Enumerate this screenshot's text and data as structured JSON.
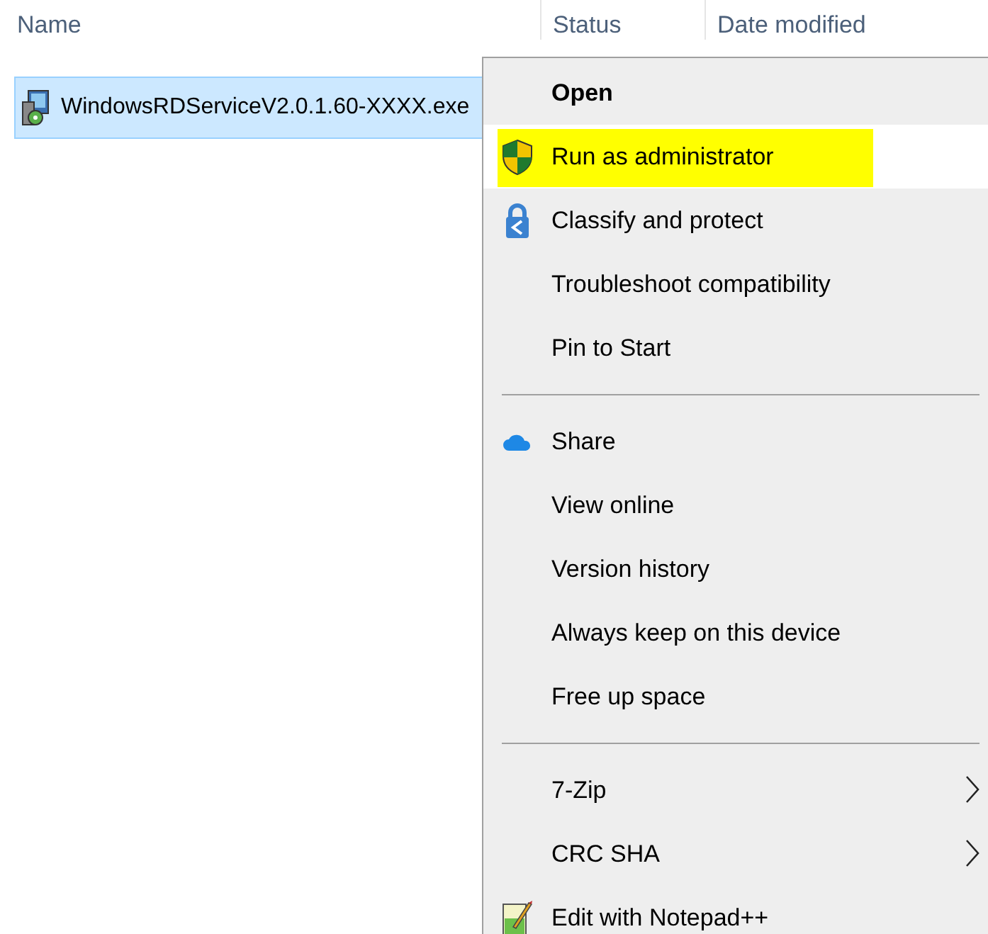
{
  "columns": [
    {
      "label": "Name"
    },
    {
      "label": "Status"
    },
    {
      "label": "Date modified"
    }
  ],
  "files": [
    {
      "name": "WindowsRDServiceV2.0.1.60-XXXX.exe",
      "selected": true
    }
  ],
  "context_menu": {
    "groups": [
      {
        "items": [
          {
            "label": "Open",
            "default": true,
            "hovered": false,
            "highlighted": false,
            "submenu": false
          },
          {
            "label": "Run as administrator",
            "default": false,
            "hovered": true,
            "highlighted": true,
            "submenu": false
          },
          {
            "label": "Classify and protect",
            "default": false,
            "hovered": false,
            "highlighted": false,
            "submenu": false
          },
          {
            "label": "Troubleshoot compatibility",
            "default": false,
            "hovered": false,
            "highlighted": false,
            "submenu": false
          },
          {
            "label": "Pin to Start",
            "default": false,
            "hovered": false,
            "highlighted": false,
            "submenu": false
          }
        ]
      },
      {
        "items": [
          {
            "label": "Share",
            "default": false,
            "hovered": false,
            "highlighted": false,
            "submenu": false
          },
          {
            "label": "View online",
            "default": false,
            "hovered": false,
            "highlighted": false,
            "submenu": false
          },
          {
            "label": "Version history",
            "default": false,
            "hovered": false,
            "highlighted": false,
            "submenu": false
          },
          {
            "label": "Always keep on this device",
            "default": false,
            "hovered": false,
            "highlighted": false,
            "submenu": false
          },
          {
            "label": "Free up space",
            "default": false,
            "hovered": false,
            "highlighted": false,
            "submenu": false
          }
        ]
      },
      {
        "items": [
          {
            "label": "7-Zip",
            "default": false,
            "hovered": false,
            "highlighted": false,
            "submenu": true
          },
          {
            "label": "CRC SHA",
            "default": false,
            "hovered": false,
            "highlighted": false,
            "submenu": true
          },
          {
            "label": "Edit with Notepad++",
            "default": false,
            "hovered": false,
            "highlighted": false,
            "submenu": false
          }
        ]
      }
    ]
  }
}
